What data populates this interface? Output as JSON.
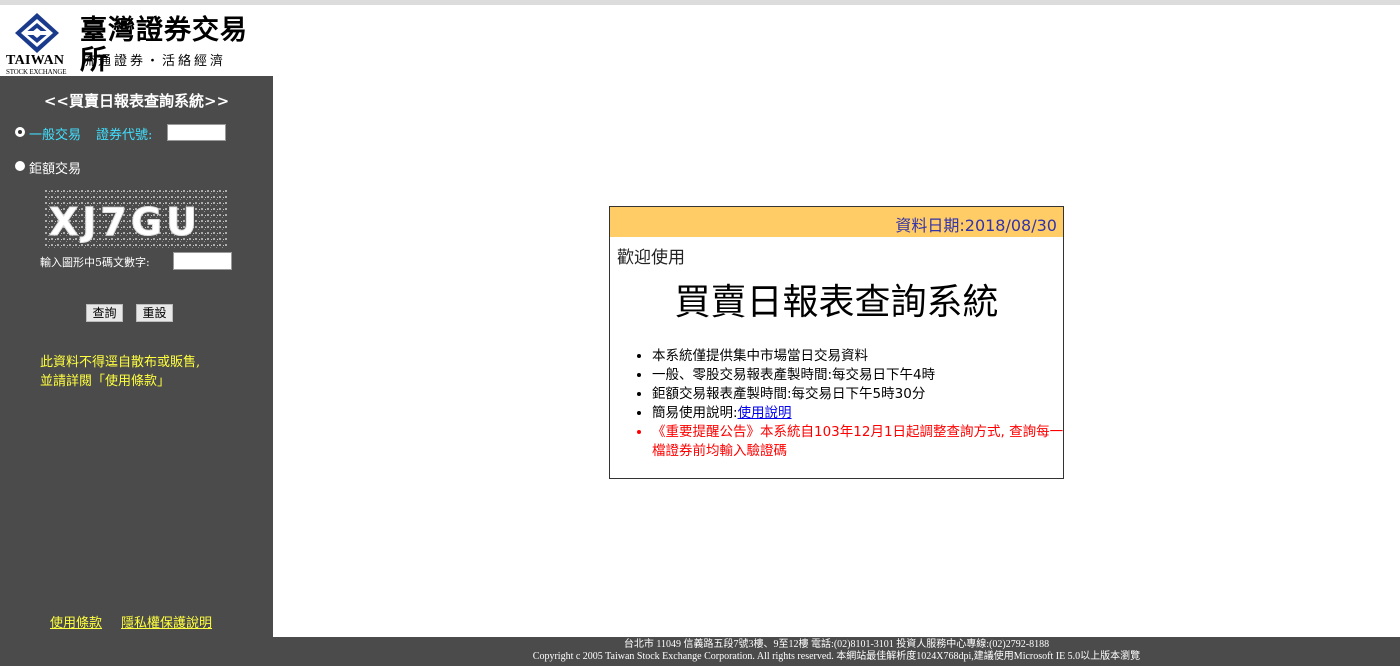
{
  "header": {
    "logo_en_line1": "TAIWAN",
    "logo_en_line2": "STOCK EXCHANGE",
    "logo_zh": "臺灣證券交易所",
    "slogan": "流通證券・活絡經濟"
  },
  "sidebar": {
    "title": "<<買賣日報表查詢系統>>",
    "radio_general_label": "一般交易",
    "security_code_label": "證券代號:",
    "security_code_value": "",
    "radio_block_label": "鉅額交易",
    "captcha_text": "XJ7GU",
    "captcha_prompt": "輸入圖形中5碼文數字:",
    "captcha_value": "",
    "query_button": "查詢",
    "reset_button": "重設",
    "notice_line1": "此資料不得逕自散布或販售,",
    "notice_line2": "並請詳閱「使用條款」",
    "link_terms": "使用條款",
    "link_privacy": "隱私權保護說明"
  },
  "panel": {
    "date_label": "資料日期:2018/08/30",
    "welcome": "歡迎使用",
    "title": "買賣日報表查詢系統",
    "bullet1": "本系統僅提供集中市場當日交易資料",
    "bullet2": "一般、零股交易報表產製時間:每交易日下午4時",
    "bullet3": "鉅額交易報表產製時間:每交易日下午5時30分",
    "bullet4_prefix": "簡易使用說明:",
    "bullet4_link": "使用說明",
    "bullet5": "《重要提醒公告》本系統自103年12月1日起調整查詢方式, 查詢每一檔證券前均輸入驗證碼"
  },
  "footer": {
    "line1": "台北市 11049 信義路五段7號3樓、9至12樓 電話:(02)8101-3101     投資人服務中心專線:(02)2792-8188",
    "line2": "Copyright c 2005 Taiwan Stock Exchange Corporation. All rights reserved. 本網站最佳解析度1024X768dpi,建議使用Microsoft IE 5.0以上版本瀏覽"
  },
  "colors": {
    "sidebar_bg": "#4b4b4b",
    "panel_header_bg": "#ffcc66",
    "accent_cyan": "#40e0ff",
    "notice_yellow": "#ffff40",
    "alert_red": "#ff0000",
    "date_blue": "#3333aa"
  }
}
